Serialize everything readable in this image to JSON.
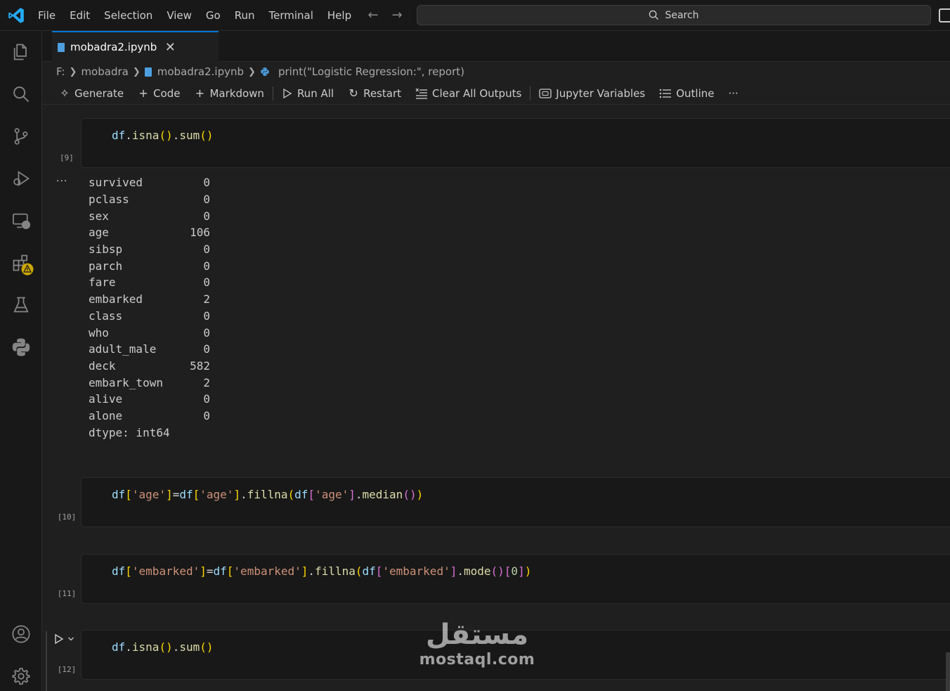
{
  "menu": [
    "File",
    "Edit",
    "Selection",
    "View",
    "Go",
    "Run",
    "Terminal",
    "Help"
  ],
  "search": {
    "label": "Search"
  },
  "tab": {
    "label": "mobadra2.ipynb"
  },
  "breadcrumb": {
    "drive": "F:",
    "folder": "mobadra",
    "file": "mobadra2.ipynb",
    "symbol": "print(\"Logistic Regression:\", report)"
  },
  "toolbar": {
    "generate": "Generate",
    "code": "Code",
    "markdown": "Markdown",
    "run_all": "Run All",
    "restart": "Restart",
    "clear_outputs": "Clear All Outputs",
    "jupyter_variables": "Jupyter Variables",
    "outline": "Outline",
    "more": "···"
  },
  "cells": [
    {
      "count": "[9]"
    },
    {
      "count": "[10]"
    },
    {
      "count": "[11]"
    },
    {
      "count": "[12]"
    }
  ],
  "output": {
    "dots": "···",
    "rows": [
      {
        "name": "survived",
        "value": "0"
      },
      {
        "name": "pclass",
        "value": "0"
      },
      {
        "name": "sex",
        "value": "0"
      },
      {
        "name": "age",
        "value": "106"
      },
      {
        "name": "sibsp",
        "value": "0"
      },
      {
        "name": "parch",
        "value": "0"
      },
      {
        "name": "fare",
        "value": "0"
      },
      {
        "name": "embarked",
        "value": "2"
      },
      {
        "name": "class",
        "value": "0"
      },
      {
        "name": "who",
        "value": "0"
      },
      {
        "name": "adult_male",
        "value": "0"
      },
      {
        "name": "deck",
        "value": "582"
      },
      {
        "name": "embark_town",
        "value": "2"
      },
      {
        "name": "alive",
        "value": "0"
      },
      {
        "name": "alone",
        "value": "0"
      }
    ],
    "dtype": "dtype: int64"
  },
  "code_tokens": {
    "df": "df",
    "isna": "isna",
    "sum": "sum",
    "fillna": "fillna",
    "median": "median",
    "mode": "mode",
    "age": "'age'",
    "embarked": "'embarked'",
    "zero": "0"
  },
  "watermark": {
    "arabic": "مستقل",
    "latin": "mostaql.com"
  },
  "colors": {
    "accent": "#0078d4",
    "background": "#1f1f1f",
    "sidebar": "#181818"
  }
}
